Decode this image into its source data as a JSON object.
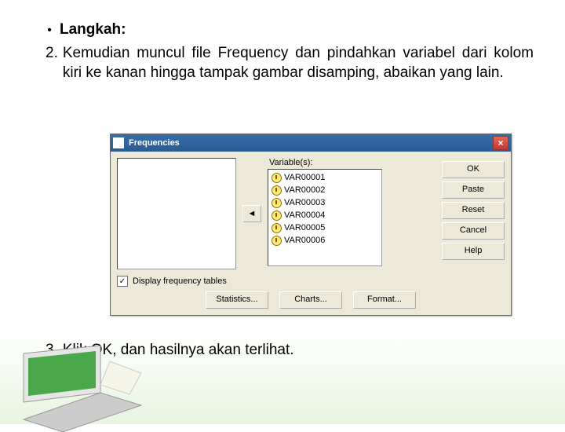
{
  "slide": {
    "bullet_heading": "Langkah:",
    "step2_num": "2.",
    "step2_text": "Kemudian muncul file Frequency dan pindahkan variabel dari kolom kiri ke kanan hingga tampak gambar disamping, abaikan yang lain.",
    "step3_num": "3.",
    "step3_text": "Klik OK, dan hasilnya akan terlihat."
  },
  "dialog": {
    "title": "Frequencies",
    "variables_label": "Variable(s):",
    "variables": [
      "VAR00001",
      "VAR00002",
      "VAR00003",
      "VAR00004",
      "VAR00005",
      "VAR00006"
    ],
    "buttons": {
      "ok": "OK",
      "paste": "Paste",
      "reset": "Reset",
      "cancel": "Cancel",
      "help": "Help"
    },
    "checkbox_label": "Display frequency tables",
    "bottom": {
      "stats": "Statistics...",
      "charts": "Charts...",
      "format": "Format..."
    }
  }
}
